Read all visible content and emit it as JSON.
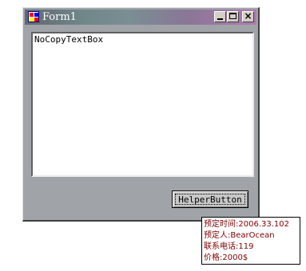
{
  "window": {
    "title": "Form1",
    "textbox_text": "NoCopyTextBox",
    "helper_button_label": "HelperButton"
  },
  "tooltip": {
    "lines": [
      "预定时间:2006.33.102",
      "预定人:BearOcean",
      "联系电话:119",
      "价格:2000$"
    ]
  },
  "icons": [
    "app-icon",
    "minimize-icon",
    "maximize-icon",
    "close-icon"
  ]
}
